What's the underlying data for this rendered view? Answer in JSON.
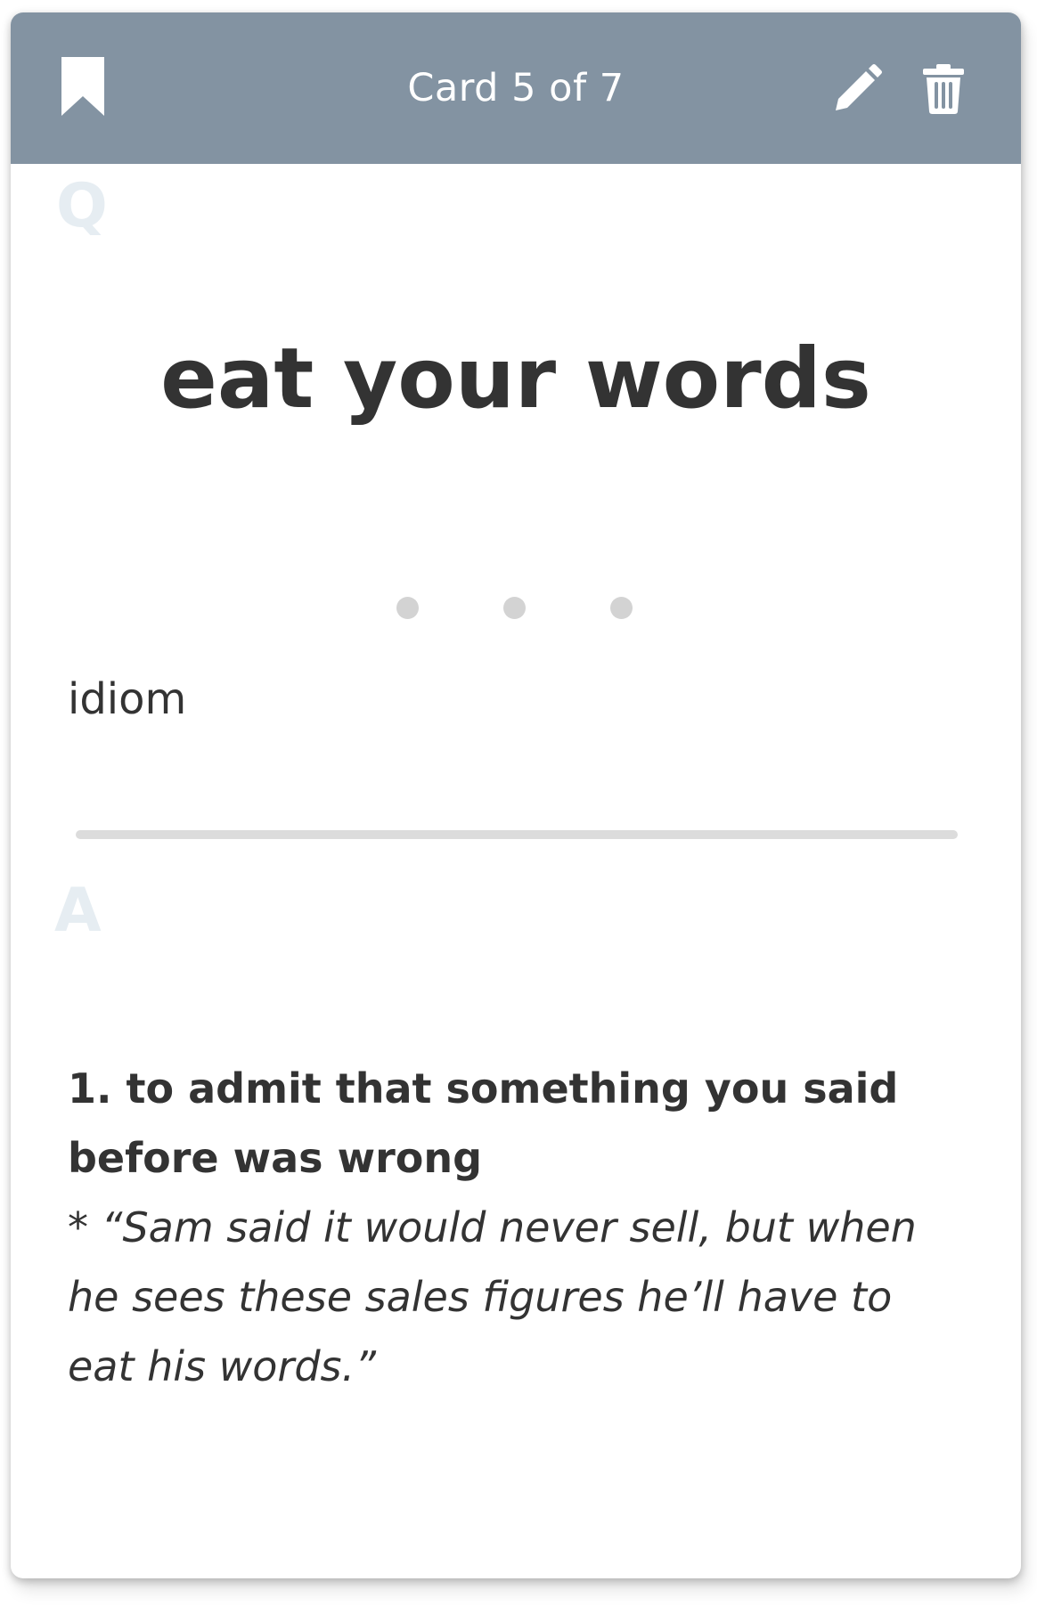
{
  "header": {
    "counter": "Card 5 of 7",
    "bookmark_icon": "bookmark-icon",
    "edit_icon": "pencil-icon",
    "delete_icon": "trash-icon",
    "background_color": "#8393a2"
  },
  "question": {
    "section_letter": "Q",
    "term": "eat your words",
    "part_of_speech": "idiom"
  },
  "answer": {
    "section_letter": "A",
    "definition": "1. to admit that something you said before was wrong",
    "example": "* “Sam said it would never sell, but when he sees these sales figures he’ll have to eat his words.”"
  }
}
